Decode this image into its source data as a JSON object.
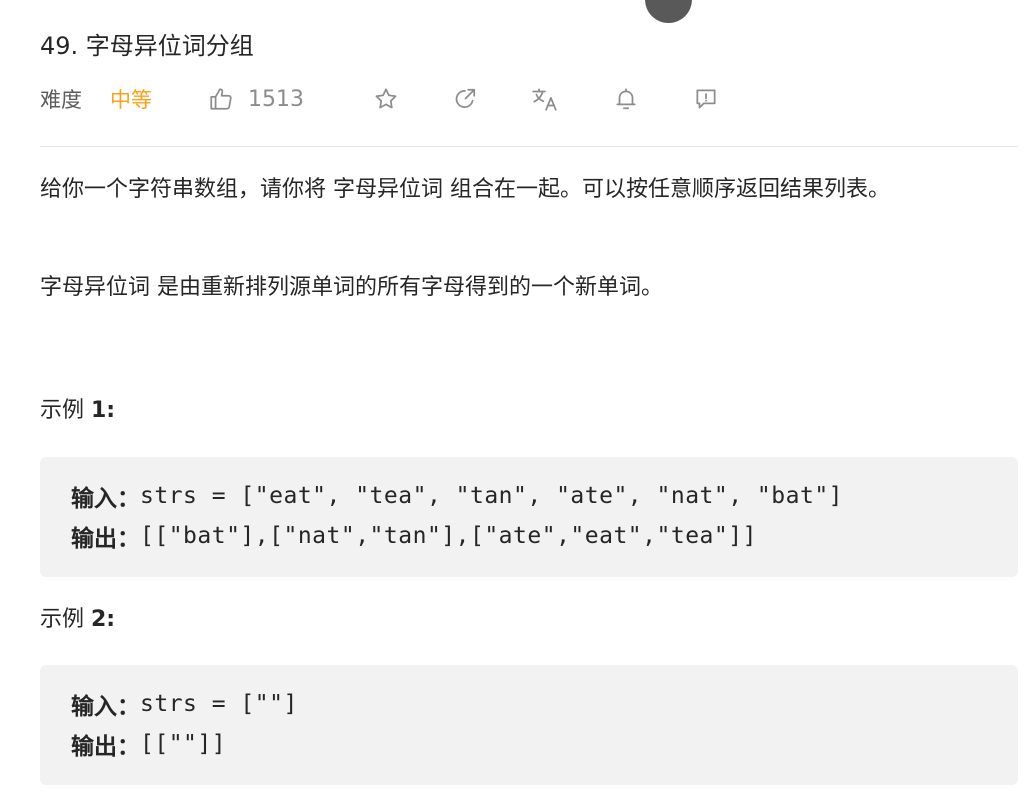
{
  "problem": {
    "title": "49. 字母异位词分组",
    "difficulty_label": "难度",
    "difficulty_value": "中等",
    "like_count": "1513",
    "accent_color": "#ffa116"
  },
  "toolbar": {
    "icons": [
      "thumbs-up-icon",
      "star-icon",
      "share-icon",
      "translate-icon",
      "bell-icon",
      "feedback-icon"
    ]
  },
  "description": {
    "paragraph1": "给你一个字符串数组，请你将 字母异位词 组合在一起。可以按任意顺序返回结果列表。",
    "paragraph2": "字母异位词 是由重新排列源单词的所有字母得到的一个新单词。"
  },
  "examples": [
    {
      "title_prefix": "示例 ",
      "title_number": "1:",
      "input_label": "输入：",
      "input_value": "strs = [\"eat\", \"tea\", \"tan\", \"ate\", \"nat\", \"bat\"]",
      "output_label": "输出：",
      "output_value": "[[\"bat\"],[\"nat\",\"tan\"],[\"ate\",\"eat\",\"tea\"]]"
    },
    {
      "title_prefix": "示例 ",
      "title_number": "2:",
      "input_label": "输入：",
      "input_value": "strs = [\"\"]",
      "output_label": "输出：",
      "output_value": "[[\"\"]]"
    }
  ]
}
